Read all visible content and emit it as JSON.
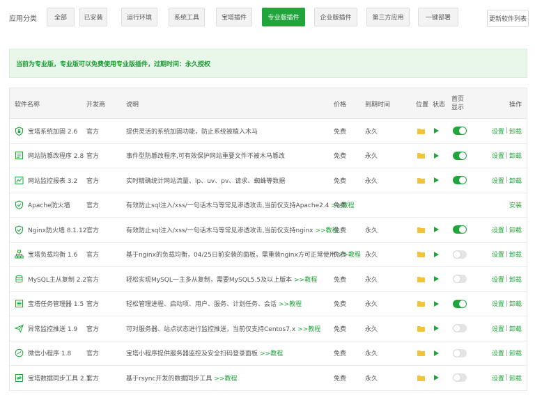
{
  "categories": {
    "label": "应用分类",
    "tabs": [
      {
        "label": "全部",
        "active": false
      },
      {
        "label": "已安装",
        "active": false
      },
      {
        "label": "运行环境",
        "active": false
      },
      {
        "label": "系统工具",
        "active": false
      },
      {
        "label": "宝塔插件",
        "active": false
      },
      {
        "label": "专业版插件",
        "active": true
      },
      {
        "label": "企业版插件",
        "active": false
      },
      {
        "label": "第三方应用",
        "active": false
      },
      {
        "label": "一键部署",
        "active": false
      }
    ],
    "update_button": "更新软件列表"
  },
  "notice": "当前为专业版，专业版可以免费使用专业版插件，过期时间：永久授权",
  "table": {
    "headers": {
      "name": "软件名称",
      "developer": "开发商",
      "description": "说明",
      "price": "价格",
      "expire": "到期时间",
      "location": "位置",
      "status": "状态",
      "homepage": "首页显示",
      "ops": "操作"
    },
    "more_label": ">>教程",
    "settings_label": "设置",
    "uninstall_label": "卸载",
    "install_label": "安装",
    "rows": [
      {
        "icon": "shield-icon",
        "name": "宝塔系统加固 2.6",
        "developer": "官方",
        "description": "提供灵活的系统加固功能，防止系统被植入木马",
        "has_more": false,
        "price": "免费",
        "expire": "永久",
        "installed": true,
        "home": true
      },
      {
        "icon": "document-icon",
        "name": "网站防篡改程序 2.8",
        "developer": "官方",
        "description": "事件型防篡改程序,可有效保护网站重要文件不被木马篡改",
        "has_more": false,
        "price": "免费",
        "expire": "永久",
        "installed": true,
        "home": true
      },
      {
        "icon": "chart-icon",
        "name": "网站监控报表 3.2",
        "developer": "官方",
        "description": "实时精确统计网站流量、ip、uv、pv、请求、蜘蛛等数据",
        "has_more": false,
        "price": "免费",
        "expire": "永久",
        "installed": true,
        "home": true
      },
      {
        "icon": "firewall-icon",
        "name": "Apache防火墙",
        "developer": "官方",
        "description": "有效防止sql注入/xss/一句话木马等常见渗透攻击,当前仅支持Apache2.4",
        "has_more": true,
        "price": "免费",
        "expire": "",
        "installed": false,
        "home": false
      },
      {
        "icon": "firewall-icon",
        "name": "Nginx防火墙 8.1.12",
        "developer": "官方",
        "description": "有效防止sql注入/xss/一句话木马等常见渗透攻击,当前仅支持nginx",
        "has_more": true,
        "price": "免费",
        "expire": "永久",
        "installed": true,
        "home": true
      },
      {
        "icon": "sitemap-icon",
        "name": "宝塔负载均衡 1.6",
        "developer": "官方",
        "description": "基于nginx的负载均衡，04/25日前安装的面板，需重装nginx方可正常使用",
        "has_more": true,
        "price": "免费",
        "expire": "永久",
        "installed": true,
        "home": false
      },
      {
        "icon": "database-icon",
        "name": "MySQL主从复制 2.2",
        "developer": "官方",
        "description": "轻松实现MySQL一主多从复制，需要MySQL5.5及以上版本",
        "has_more": true,
        "price": "免费",
        "expire": "永久",
        "installed": true,
        "home": false
      },
      {
        "icon": "task-list-icon",
        "name": "宝塔任务管理器 1.5",
        "developer": "官方",
        "description": "轻松管理进程、启动项、用户、服务、计划任务、会话",
        "has_more": true,
        "price": "免费",
        "expire": "永久",
        "installed": true,
        "home": true
      },
      {
        "icon": "send-icon",
        "name": "异常监控推送 1.9",
        "developer": "官方",
        "description": "可对服务器、站点状态进行监控推送，当前仅支持Centos7.x",
        "has_more": true,
        "price": "免费",
        "expire": "永久",
        "installed": true,
        "home": false
      },
      {
        "icon": "miniapp-icon",
        "name": "微信小程序 1.8",
        "developer": "官方",
        "description": "宝塔小程序提供服务器监控及安全扫码登录面板",
        "has_more": true,
        "price": "免费",
        "expire": "永久",
        "installed": true,
        "home": false
      },
      {
        "icon": "sync-icon",
        "name": "宝塔数据同步工具 2.3",
        "developer": "官方",
        "description": "基于rsync开发的数据同步工具",
        "has_more": true,
        "price": "免费",
        "expire": "永久",
        "installed": true,
        "home": false
      }
    ]
  },
  "colors": {
    "accent": "#20a53a",
    "folder": "#f5c33b"
  }
}
